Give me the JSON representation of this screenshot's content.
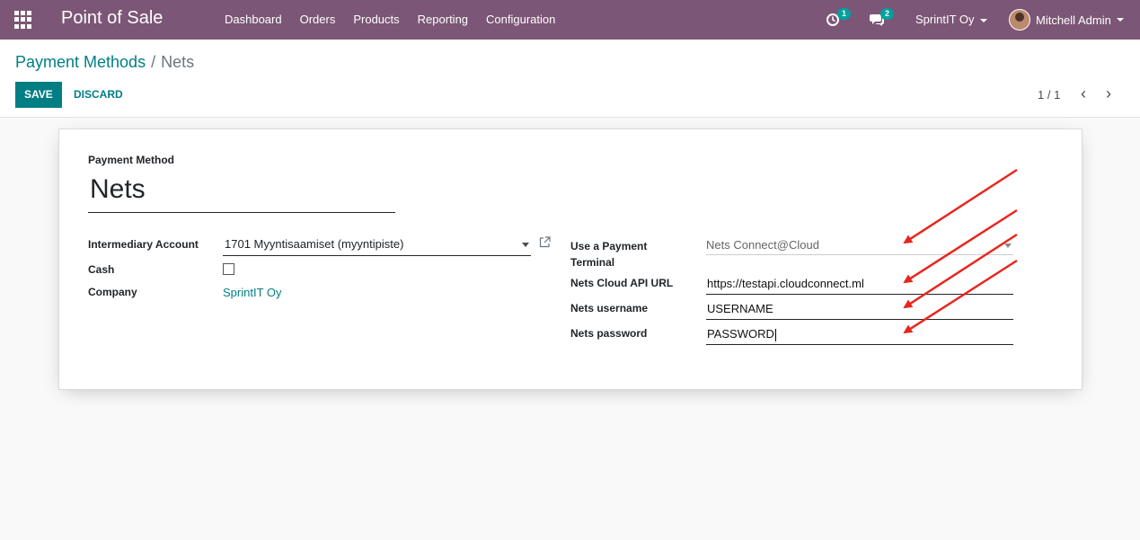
{
  "navbar": {
    "app_title": "Point of Sale",
    "menu": [
      "Dashboard",
      "Orders",
      "Products",
      "Reporting",
      "Configuration"
    ],
    "activity_count": "1",
    "messages_count": "2",
    "company": "SprintIT Oy",
    "user": "Mitchell Admin",
    "color": "#7c5676"
  },
  "control_panel": {
    "breadcrumb_parent": "Payment Methods",
    "breadcrumb_sep": "/",
    "breadcrumb_current": "Nets",
    "save_label": "SAVE",
    "discard_label": "DISCARD",
    "pager": "1 / 1"
  },
  "form": {
    "payment_method_label": "Payment Method",
    "payment_method_name": "Nets",
    "intermediary_account_label": "Intermediary Account",
    "intermediary_account_value": "1701 Myyntisaamiset (myyntipiste)",
    "cash_label": "Cash",
    "cash_checked": false,
    "company_label": "Company",
    "company_value": "SprintIT Oy",
    "terminal_label": "Use a Payment Terminal",
    "terminal_value": "Nets Connect@Cloud",
    "api_url_label": "Nets Cloud API URL",
    "api_url_value": "https://testapi.cloudconnect.ml",
    "username_label": "Nets username",
    "username_value": "USERNAME",
    "password_label": "Nets password",
    "password_value": "PASSWORD"
  },
  "accent_color": "#017e84",
  "annotation_color": "#e8261e"
}
